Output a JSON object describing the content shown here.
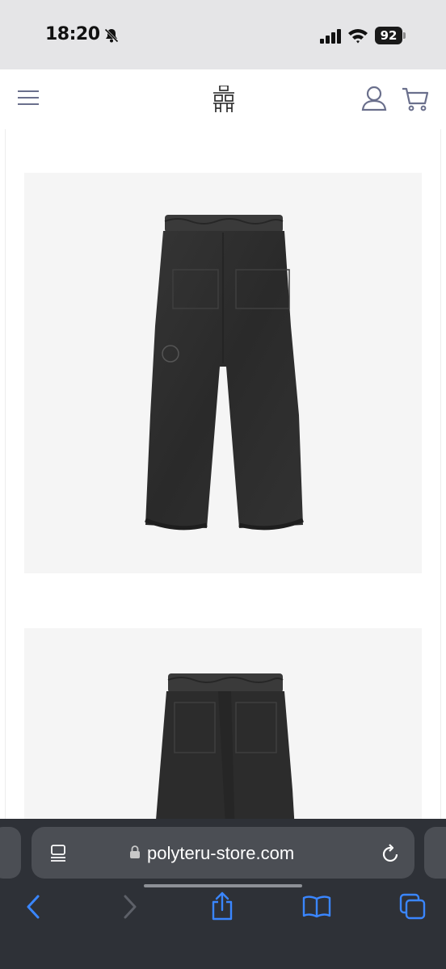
{
  "status_bar": {
    "time": "18:20",
    "battery": "92",
    "icons": [
      "bell-slash-icon",
      "signal-icon",
      "wifi-icon",
      "battery-icon"
    ]
  },
  "header": {
    "icons": [
      "hamburger-menu-icon",
      "brand-logo",
      "user-icon",
      "cart-icon"
    ]
  },
  "product": {
    "images": [
      {
        "name": "pants-front-view",
        "color": "#2b2b2b"
      },
      {
        "name": "pants-back-view",
        "color": "#2b2b2b"
      }
    ]
  },
  "browser": {
    "url": "polyteru-store.com",
    "icons": [
      "tabs-overview-icon",
      "lock-icon",
      "reload-icon",
      "back-icon",
      "forward-icon",
      "share-icon",
      "bookmarks-icon",
      "tabs-icon"
    ],
    "accent_color": "#3a86ff"
  }
}
